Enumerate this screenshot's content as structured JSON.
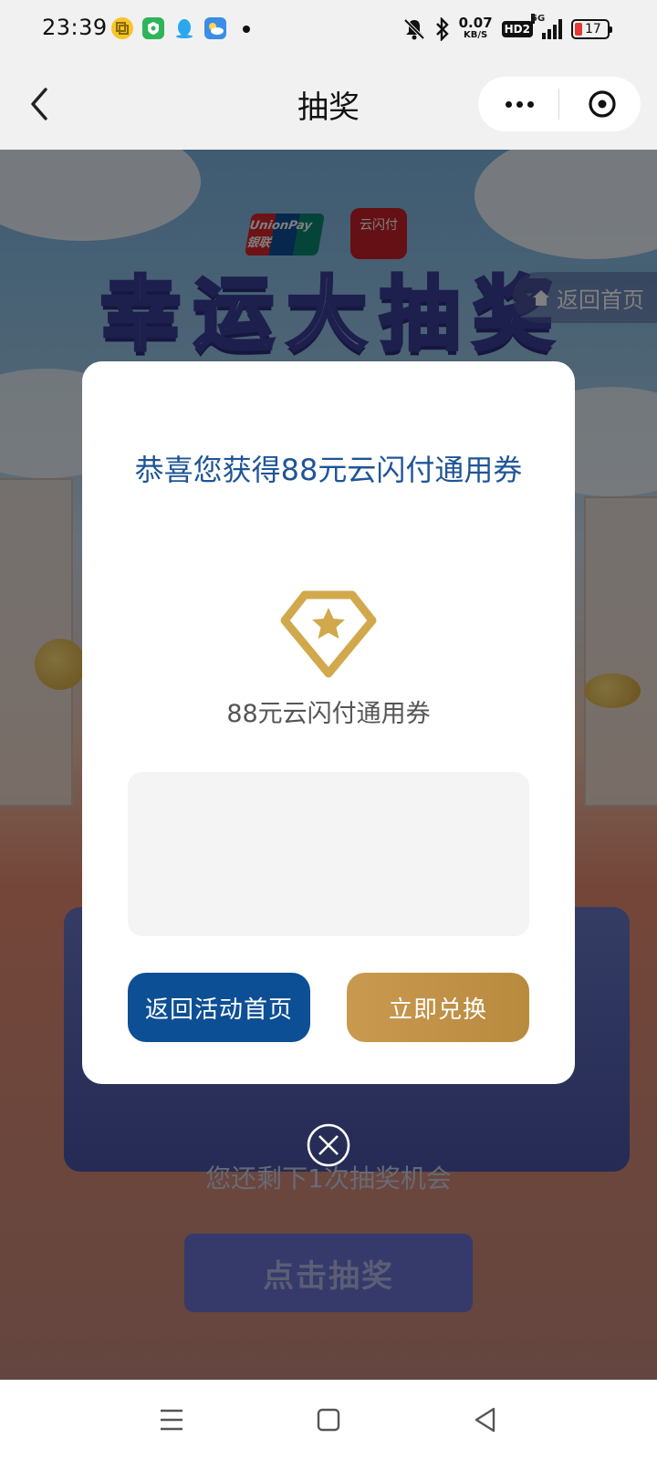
{
  "status_bar": {
    "time": "23:39",
    "net_speed_value": "0.07",
    "net_speed_unit": "KB/S",
    "hd_label": "HD2",
    "network_label": "5G",
    "battery_level": "17",
    "battery_color": "#e53935"
  },
  "header": {
    "title": "抽奖"
  },
  "page": {
    "brand_unionpay_text": "UnionPay 银联",
    "brand_yunshanfu_text": "云闪付",
    "banner_title": "幸运大抽奖",
    "home_chip_label": "返回首页",
    "remaining_text": "您还剩下1次抽奖机会",
    "draw_button_label": "点击抽奖"
  },
  "modal": {
    "title": "恭喜您获得88元云闪付通用券",
    "prize_icon": "diamond-star-icon",
    "prize_name": "88元云闪付通用券",
    "back_button_label": "返回活动首页",
    "redeem_button_label": "立即兑换",
    "title_color": "#1f5597",
    "back_button_color": "#0d4f95",
    "redeem_button_color": "#c9994f",
    "icon_color": "#d1a94c"
  },
  "nav_bar": {
    "icons": [
      "menu-icon",
      "home-square-icon",
      "back-triangle-icon"
    ]
  }
}
